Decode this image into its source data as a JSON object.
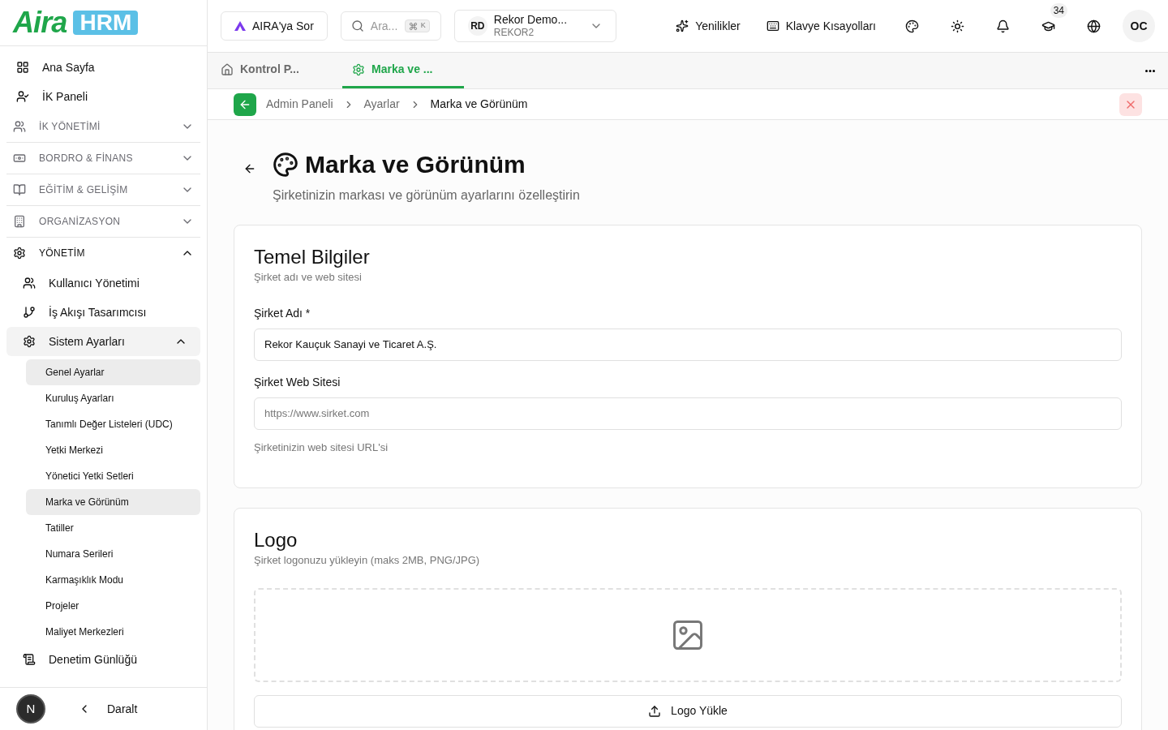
{
  "sidebar": {
    "logo": {
      "text": "Aira",
      "badge": "HRM"
    },
    "items": [
      {
        "kind": "link",
        "label": "Ana Sayfa"
      },
      {
        "kind": "link",
        "label": "İK Paneli"
      },
      {
        "kind": "section",
        "label": "İK YÖNETİMİ",
        "expanded": false
      },
      {
        "kind": "section",
        "label": "BORDRO & FİNANS",
        "expanded": false
      },
      {
        "kind": "section",
        "label": "EĞİTİM & GELİŞİM",
        "expanded": false
      },
      {
        "kind": "section",
        "label": "ORGANİZASYON",
        "expanded": false
      },
      {
        "kind": "section",
        "label": "YÖNETİM",
        "expanded": true,
        "children": [
          {
            "kind": "link",
            "label": "Kullanıcı Yönetimi"
          },
          {
            "kind": "link",
            "label": "İş Akışı Tasarımcısı"
          },
          {
            "kind": "group",
            "label": "Sistem Ayarları",
            "expanded": true,
            "children": [
              {
                "label": "Genel Ayarlar",
                "selected": true
              },
              {
                "label": "Kuruluş Ayarları",
                "selected": false
              },
              {
                "label": "Tanımlı Değer Listeleri (UDC)",
                "selected": false
              },
              {
                "label": "Yetki Merkezi",
                "selected": false
              },
              {
                "label": "Yönetici Yetki Setleri",
                "selected": false
              },
              {
                "label": "Marka ve Görünüm",
                "selected": true
              },
              {
                "label": "Tatiller",
                "selected": false
              },
              {
                "label": "Numara Serileri",
                "selected": false
              },
              {
                "label": "Karmaşıklık Modu",
                "selected": false
              },
              {
                "label": "Projeler",
                "selected": false
              },
              {
                "label": "Maliyet Merkezleri",
                "selected": false
              }
            ]
          },
          {
            "kind": "link",
            "label": "Denetim Günlüğü"
          }
        ]
      }
    ],
    "avatar": "N",
    "collapse": "Daralt"
  },
  "header": {
    "ask": "AIRA'ya Sor",
    "search": {
      "placeholder": "Ara...",
      "shortcut": "K"
    },
    "company": {
      "initials": "RD",
      "name": "Rekor Demo...",
      "code": "REKOR2"
    },
    "news": "Yenilikler",
    "shortcuts": "Klavye Kısayolları",
    "training_badge": "34",
    "user": "OC"
  },
  "tabs": [
    {
      "label": "Kontrol P...",
      "selected": false
    },
    {
      "label": "Marka ve ...",
      "selected": true
    }
  ],
  "breadcrumb": [
    "Admin Paneli",
    "Ayarlar",
    "Marka ve Görünüm"
  ],
  "page": {
    "title": "Marka ve Görünüm",
    "subtitle": "Şirketinizin markası ve görünüm ayarlarını özelleştirin"
  },
  "basic": {
    "title": "Temel Bilgiler",
    "subtitle": "Şirket adı ve web sitesi",
    "fields": [
      {
        "label": "Şirket Adı *",
        "value": "Rekor Kauçuk Sanayi ve Ticaret A.Ş."
      },
      {
        "label": "Şirket Web Sitesi",
        "placeholder": "https://www.sirket.com",
        "help": "Şirketinizin web sitesi URL'si"
      }
    ]
  },
  "logo": {
    "title": "Logo",
    "subtitle": "Şirket logonuzu yükleyin (maks 2MB, PNG/JPG)",
    "upload": "Logo Yükle"
  }
}
